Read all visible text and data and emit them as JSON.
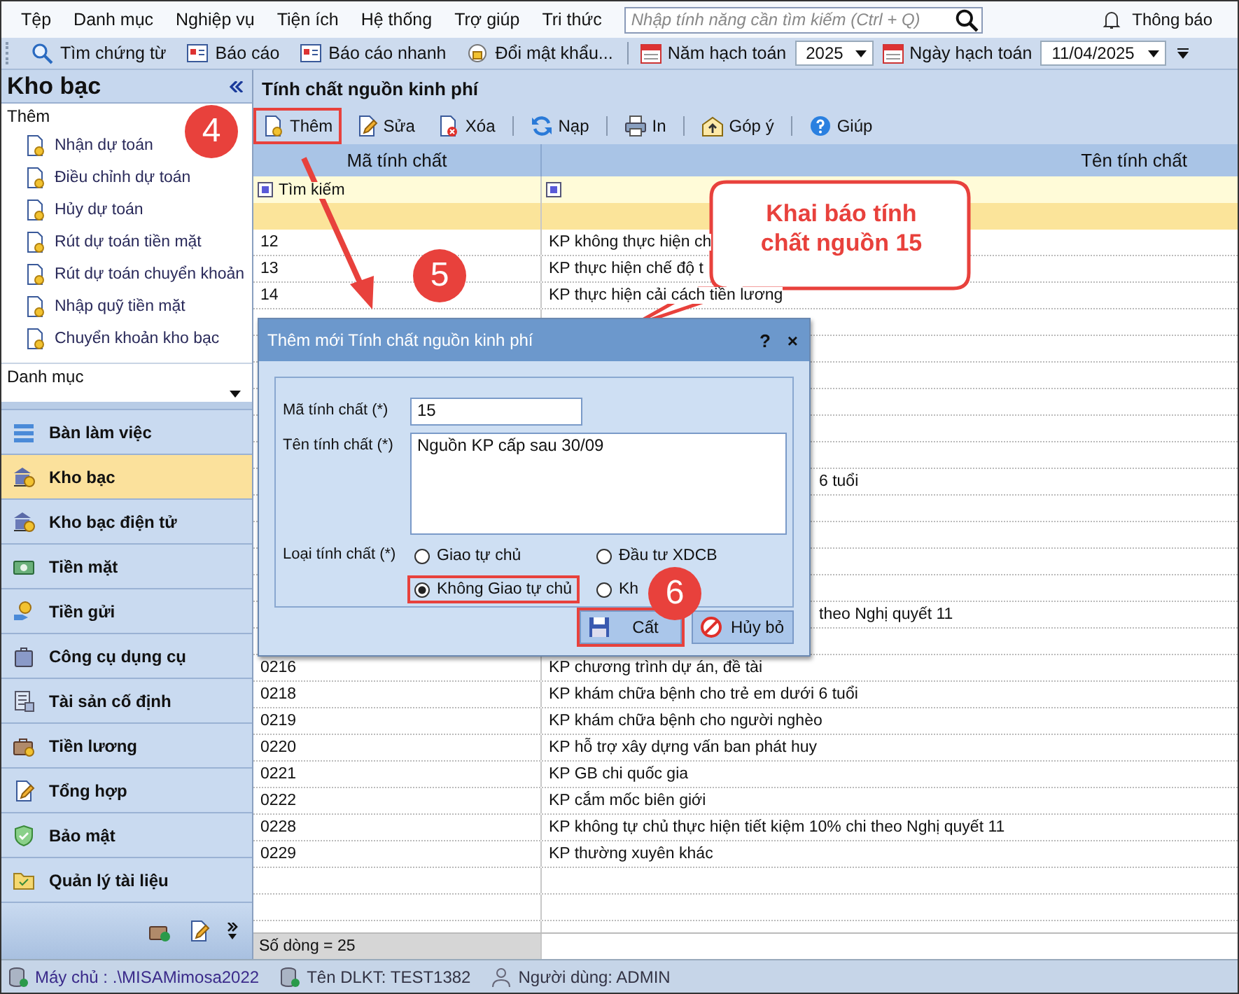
{
  "menu": [
    "Tệp",
    "Danh mục",
    "Nghiệp vụ",
    "Tiện ích",
    "Hệ thống",
    "Trợ giúp",
    "Tri thức"
  ],
  "search": {
    "placeholder": "Nhập tính năng cần tìm kiếm (Ctrl + Q)"
  },
  "notifications": "Thông báo",
  "toolbar": [
    "Tìm chứng từ",
    "Báo cáo",
    "Báo cáo nhanh",
    "Đổi mật khẩu..."
  ],
  "year": {
    "label": "Năm hạch toán",
    "value": "2025"
  },
  "date": {
    "label": "Ngày hạch toán",
    "value": "11/04/2025"
  },
  "sidebar": {
    "title": "Kho bạc",
    "group": "Thêm",
    "items": [
      "Nhận dự toán",
      "Điều chỉnh dự toán",
      "Hủy dự toán",
      "Rút dự toán tiền mặt",
      "Rút dự toán chuyển khoản",
      "Nhập quỹ tiền mặt",
      "Chuyển khoản kho bạc"
    ],
    "group_2": "Danh mục",
    "nav": [
      {
        "label": "Bàn làm việc",
        "selected": false
      },
      {
        "label": "Kho bạc",
        "selected": true
      },
      {
        "label": "Kho bạc điện tử",
        "selected": false
      },
      {
        "label": "Tiền mặt",
        "selected": false
      },
      {
        "label": "Tiền gửi",
        "selected": false
      },
      {
        "label": "Công cụ dụng cụ",
        "selected": false
      },
      {
        "label": "Tài sản cố định",
        "selected": false
      },
      {
        "label": "Tiền lương",
        "selected": false
      },
      {
        "label": "Tổng hợp",
        "selected": false
      },
      {
        "label": "Bảo mật",
        "selected": false
      },
      {
        "label": "Quản lý tài liệu",
        "selected": false
      }
    ]
  },
  "page": {
    "title": "Tính chất nguồn kinh phí",
    "actions": [
      {
        "label": "Thêm",
        "highlighted": true
      },
      {
        "label": "Sửa",
        "highlighted": false
      },
      {
        "label": "Xóa",
        "highlighted": false
      },
      {
        "label": "Nạp",
        "highlighted": false
      },
      {
        "label": "In",
        "highlighted": false
      },
      {
        "label": "Góp ý",
        "highlighted": false
      },
      {
        "label": "Giúp",
        "highlighted": false
      }
    ],
    "table": {
      "columns": [
        "Mã tính chất",
        "Tên tính chất"
      ],
      "filter_placeholder": "Tìm kiếm",
      "rows": [
        {
          "kind": "row",
          "code": "12",
          "name": "KP không thực hiện ch"
        },
        {
          "kind": "row",
          "code": "13",
          "name": "KP thực hiện chế độ t"
        },
        {
          "kind": "row",
          "code": "14",
          "name": "KP thực hiện cải cách tiền lương"
        },
        {
          "kind": "covered"
        },
        {
          "kind": "covered"
        },
        {
          "kind": "covered"
        },
        {
          "kind": "covered"
        },
        {
          "kind": "covered"
        },
        {
          "kind": "covered"
        },
        {
          "kind": "partial",
          "name": "6 tuổi"
        },
        {
          "kind": "covered"
        },
        {
          "kind": "covered"
        },
        {
          "kind": "covered"
        },
        {
          "kind": "covered"
        },
        {
          "kind": "partial",
          "name": "theo Nghị quyết 11"
        },
        {
          "kind": "covered"
        },
        {
          "kind": "row",
          "code": "0216",
          "name": "KP chương trình dự án, đề tài"
        },
        {
          "kind": "row",
          "code": "0218",
          "name": "KP khám chữa bệnh cho trẻ em dưới 6 tuổi"
        },
        {
          "kind": "row",
          "code": "0219",
          "name": "KP khám chữa bệnh cho người nghèo"
        },
        {
          "kind": "row",
          "code": "0220",
          "name": "KP hỗ trợ xây dựng vấn ban phát huy"
        },
        {
          "kind": "row",
          "code": "0221",
          "name": "KP GB chi quốc gia"
        },
        {
          "kind": "row",
          "code": "0222",
          "name": "KP cắm mốc biên giới"
        },
        {
          "kind": "row",
          "code": "0228",
          "name": "KP không tự chủ thực hiện tiết kiệm 10% chi theo Nghị quyết 11"
        },
        {
          "kind": "row",
          "code": "0229",
          "name": "KP thường xuyên khác"
        }
      ],
      "footer": "Số dòng = 25"
    }
  },
  "dialog": {
    "title": "Thêm mới Tính chất nguồn kinh phí",
    "help": "?",
    "close": "×",
    "code": {
      "label": "Mã tính chất (*)",
      "value": "15"
    },
    "name": {
      "label": "Tên tính chất (*)",
      "value": "Nguồn KP cấp sau 30/09"
    },
    "type": {
      "label": "Loại tính chất (*)",
      "options": [
        {
          "label": "Giao tự chủ",
          "selected": false,
          "highlighted": false
        },
        {
          "label": "Đầu tư XDCB",
          "selected": false,
          "highlighted": false
        },
        {
          "label": "Không Giao tự chủ",
          "selected": true,
          "highlighted": true
        },
        {
          "label": "Kh",
          "selected": false,
          "highlighted": false
        }
      ]
    },
    "buttons": [
      {
        "kind": "save",
        "label": "Cất",
        "highlighted": true
      },
      {
        "kind": "cancel",
        "label": "Hủy bỏ",
        "highlighted": false
      }
    ]
  },
  "callout": "Khai báo tính chất nguồn 15",
  "steps": [
    "4",
    "5",
    "6"
  ],
  "status_bar": [
    "Máy chủ : .\\MISAMimosa2022",
    "Tên DLKT: TEST1382",
    "Người dùng: ADMIN"
  ]
}
